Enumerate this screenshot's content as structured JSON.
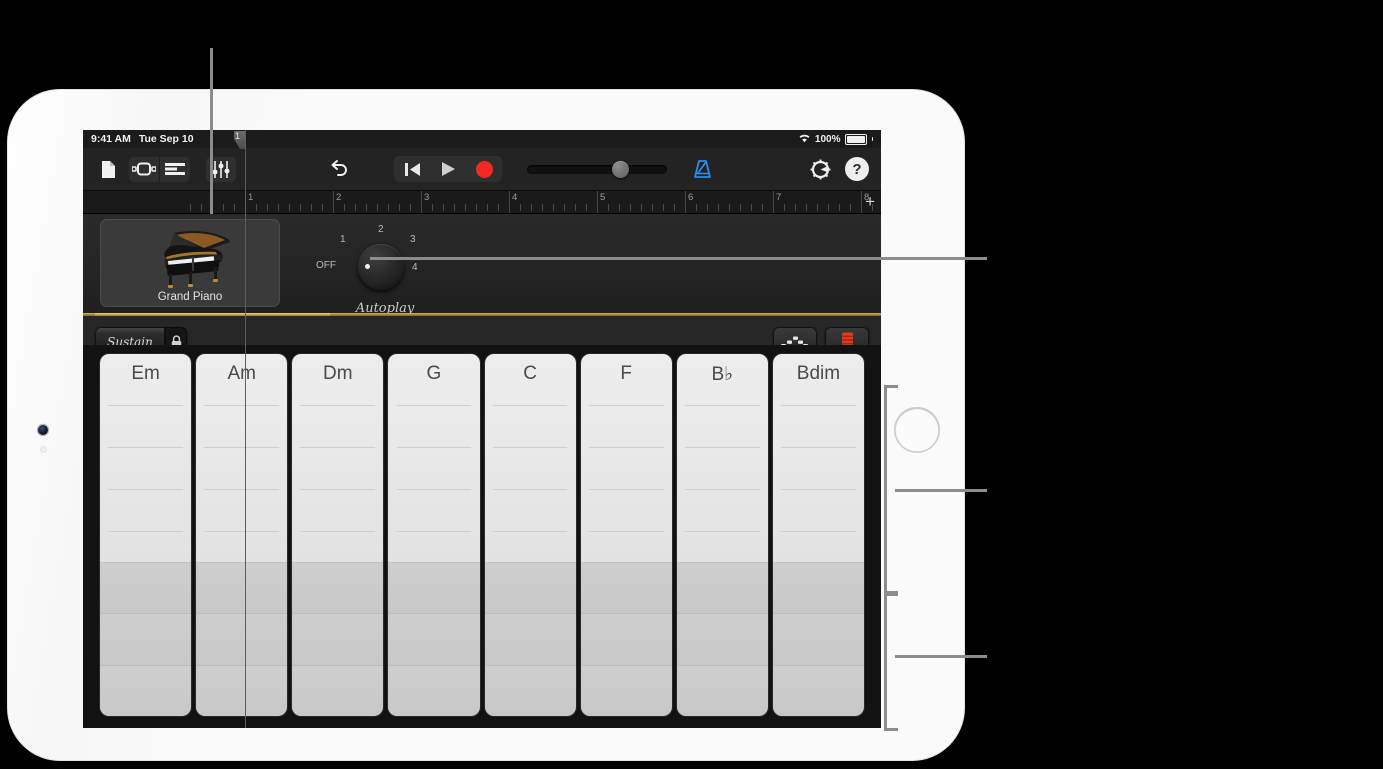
{
  "device": {
    "name": "iPad",
    "home_button": "home-button",
    "camera": "front-camera"
  },
  "status_bar": {
    "time": "9:41 AM",
    "date": "Tue Sep 10",
    "wifi": "wifi-icon",
    "battery_percent": "100%"
  },
  "toolbar": {
    "my_songs_label": "documents-icon",
    "browser_label": "instrument-browser-icon",
    "tracks_label": "track-view-icon",
    "mixer_label": "fx-settings-icon",
    "undo_label": "undo-icon",
    "rewind_label": "rewind-icon",
    "play_label": "play-icon",
    "record_label": "record-icon",
    "master_volume_label": "master-volume-slider",
    "metronome_label": "metronome-icon",
    "settings_label": "settings-gear-icon",
    "help_label": "help-icon"
  },
  "ruler": {
    "bars": [
      "1",
      "2",
      "3",
      "4",
      "5",
      "6",
      "7",
      "8"
    ],
    "playhead_bar": "1",
    "add_section_label": "+"
  },
  "instrument": {
    "name": "Grand Piano",
    "image": "grand-piano-image"
  },
  "autoplay": {
    "title": "Autoplay",
    "positions": [
      "OFF",
      "1",
      "2",
      "3",
      "4"
    ],
    "value": "OFF"
  },
  "pedal_row": {
    "sustain_label": "Sustain",
    "lock_label": "lock-icon",
    "arpeggiator_label": "arpeggiator-icon",
    "chords_toggle_label": "chord-strips-icon"
  },
  "chord_strips": {
    "chords": [
      "Em",
      "Am",
      "Dm",
      "G",
      "C",
      "F",
      "B♭",
      "Bdim"
    ],
    "top_rows": 4,
    "bottom_rows": 3
  },
  "colors": {
    "accent_blue": "#2a8cf0",
    "record_red": "#f02a22",
    "brass": "#d8b25a",
    "screen_bg": "#121212",
    "strip_light": "#ededed",
    "strip_dark": "#cecece"
  }
}
